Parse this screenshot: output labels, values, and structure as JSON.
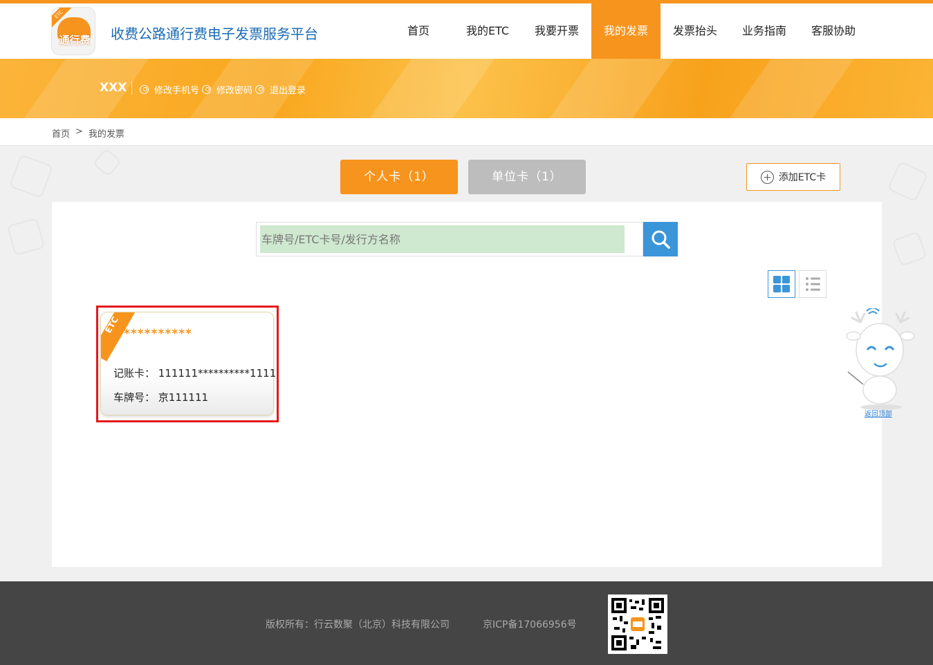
{
  "header": {
    "logo_text": "通行费",
    "logo_tag": "ETC",
    "site_title": "收费公路通行费电子发票服务平台",
    "nav": [
      {
        "label": "首页",
        "active": false
      },
      {
        "label": "我的ETC",
        "active": false
      },
      {
        "label": "我要开票",
        "active": false
      },
      {
        "label": "我的发票",
        "active": true
      },
      {
        "label": "发票抬头",
        "active": false
      },
      {
        "label": "业务指南",
        "active": false
      },
      {
        "label": "客服协助",
        "active": false
      }
    ]
  },
  "user": {
    "name": "XXX",
    "links": [
      "修改手机号",
      "修改密码",
      "退出登录"
    ]
  },
  "breadcrumb": {
    "home": "首页",
    "separator": ">",
    "current": "我的发票"
  },
  "tabs": {
    "personal": "个人卡（1）",
    "company": "单位卡（1）"
  },
  "add_card_label": "添加ETC卡",
  "search": {
    "placeholder": "车牌号/ETC卡号/发行方名称"
  },
  "icons": {
    "search": "search-icon",
    "grid_view": "grid-view-icon",
    "list_view": "list-view-icon",
    "add": "plus-circle-icon",
    "user": "person-icon"
  },
  "card": {
    "tag": "ETC",
    "name": "**********",
    "card_number_label": "记账卡：",
    "card_number": "111111**********1111",
    "plate_label": "车牌号：",
    "plate": "京111111"
  },
  "back_to_top": "返回顶部",
  "footer": {
    "copyright": "版权所有：行云数聚（北京）科技有限公司",
    "icp": "京ICP备17066956号"
  },
  "colors": {
    "accent": "#f7941d",
    "brand_blue": "#1a6bb5",
    "search_blue": "#3b95d9",
    "highlight_red": "#e5171a",
    "footer_bg": "#454545"
  }
}
